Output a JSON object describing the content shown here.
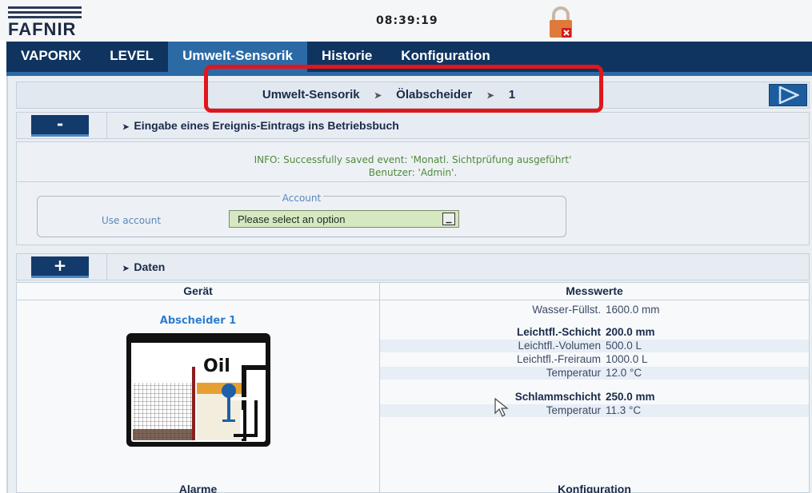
{
  "header": {
    "logo_text": "FAFNIR",
    "clock": "08:39:19"
  },
  "nav": {
    "tabs": [
      {
        "label": "VAPORIX",
        "active": false
      },
      {
        "label": "LEVEL",
        "active": false
      },
      {
        "label": "Umwelt-Sensorik",
        "active": true
      },
      {
        "label": "Historie",
        "active": false
      },
      {
        "label": "Konfiguration",
        "active": false
      }
    ]
  },
  "breadcrumb": {
    "items": [
      "Umwelt-Sensorik",
      "Ölabscheider",
      "1"
    ],
    "separator": "➤"
  },
  "event_section": {
    "toggle_label": "-",
    "title": "Eingabe eines Ereignis-Eintrags ins Betriebsbuch",
    "info_line1": "INFO: Successfully saved event: 'Monatl. Sichtprüfung ausgeführt'",
    "info_line2": "Benutzer: 'Admin'.",
    "account_legend": "Account",
    "account_label": "Use account",
    "account_select_value": "Please select an option"
  },
  "data_section": {
    "toggle_label": "+",
    "title": "Daten",
    "col_geraet": "Gerät",
    "col_messwerte": "Messwerte",
    "device_name": "Abscheider 1",
    "tank_label": "Oil",
    "measurements": [
      {
        "key": "Wasser-Füllst.",
        "value": "1600.0 mm",
        "bold": false
      },
      {
        "key": "Leichtfl.-Schicht",
        "value": "200.0 mm",
        "bold": true
      },
      {
        "key": "Leichtfl.-Volumen",
        "value": "500.0 L",
        "bold": false
      },
      {
        "key": "Leichtfl.-Freiraum",
        "value": "1000.0 L",
        "bold": false
      },
      {
        "key": "Temperatur",
        "value": "12.0 °C",
        "bold": false
      },
      {
        "key": "Schlammschicht",
        "value": "250.0 mm",
        "bold": true
      },
      {
        "key": "Temperatur",
        "value": "11.3 °C",
        "bold": false
      }
    ],
    "col_alarme": "Alarme",
    "col_konfiguration": "Konfiguration"
  },
  "colors": {
    "nav_bg": "#0f3460",
    "nav_active": "#2c6aa6",
    "info_text": "#4e8a3c",
    "highlight": "#e0161c",
    "select_bg": "#d5e8c2"
  }
}
